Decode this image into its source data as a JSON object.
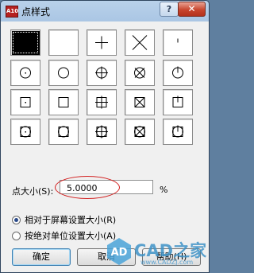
{
  "window": {
    "title": "点样式",
    "app_icon_text": "A10",
    "help_button": "?",
    "close_button": "✕"
  },
  "point_styles": {
    "selected_index": 0,
    "icons": [
      "point-dot-icon",
      "point-none-icon",
      "point-plus-icon",
      "point-x-icon",
      "point-tick-icon",
      "point-circle-icon",
      "point-circle-none-icon",
      "point-circle-plus-icon",
      "point-circle-x-icon",
      "point-circle-tick-icon",
      "point-square-dot-icon",
      "point-square-icon",
      "point-square-plus-icon",
      "point-square-x-icon",
      "point-square-tick-icon",
      "point-circle-square-dot-icon",
      "point-circle-square-icon",
      "point-circle-square-plus-icon",
      "point-circle-square-x-icon",
      "point-circle-square-tick-icon"
    ]
  },
  "point_size": {
    "label": "点大小(S):",
    "value": "5.0000",
    "unit": "%"
  },
  "size_mode": {
    "options": [
      {
        "label": "相对于屏幕设置大小(R)",
        "checked": true
      },
      {
        "label": "按绝对单位设置大小(A)",
        "checked": false
      }
    ]
  },
  "buttons": {
    "ok": "确定",
    "cancel": "取消",
    "help": "帮助(H)"
  },
  "watermark": {
    "logo_text": "AD",
    "text": "CAD之家",
    "url": "www.CADZJ.com"
  },
  "colors": {
    "selection_ring": "#d21f1f",
    "watermark": "#3f93c7"
  }
}
